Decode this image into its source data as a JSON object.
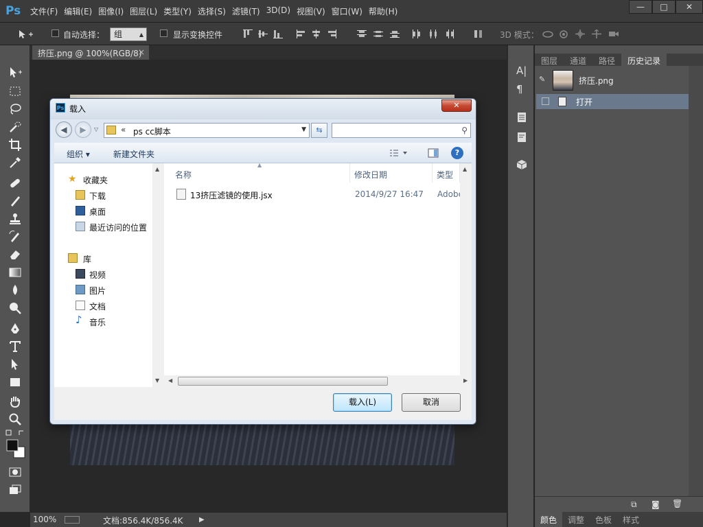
{
  "app": {
    "logo": "Ps",
    "menu": [
      "文件(F)",
      "编辑(E)",
      "图像(I)",
      "图层(L)",
      "类型(Y)",
      "选择(S)",
      "滤镜(T)",
      "3D(D)",
      "视图(V)",
      "窗口(W)",
      "帮助(H)"
    ]
  },
  "window_controls": {
    "minimize": "—",
    "maximize": "□",
    "close": "✕"
  },
  "options_bar": {
    "auto_select_label": "自动选择：",
    "auto_select_value": "组",
    "show_transform_label": "显示变换控件",
    "mode_3d_label": "3D 模式："
  },
  "document": {
    "tab_title": "挤压.png @ 100%(RGB/8)",
    "tab_close": "×"
  },
  "status": {
    "zoom": "100%",
    "doc_info": "文档:856.4K/856.4K"
  },
  "panel": {
    "tabs": [
      "图层",
      "通道",
      "路径",
      "历史记录"
    ],
    "active_tab": "历史记录",
    "snapshot_name": "挤压.png",
    "history_items": [
      "打开"
    ],
    "bottom_tabs": [
      "颜色",
      "调整",
      "色板",
      "样式"
    ]
  },
  "dialog": {
    "title": "载入",
    "close": "✕",
    "back": "◀",
    "forward": "▶",
    "path_chevron": "«",
    "path": "ps cc脚本",
    "search_placeholder": "",
    "organize": "组织 ▾",
    "new_folder": "新建文件夹",
    "help": "?",
    "nav": {
      "favorites": "收藏夹",
      "favorites_items": [
        "下载",
        "桌面",
        "最近访问的位置"
      ],
      "library": "库",
      "library_items": [
        "视频",
        "图片",
        "文档",
        "音乐"
      ]
    },
    "columns": {
      "name": "名称",
      "date": "修改日期",
      "type": "类型"
    },
    "files": [
      {
        "name": "13挤压滤镜的使用.jsx",
        "date": "2014/9/27 16:47",
        "type": "Adobe"
      }
    ],
    "load_button": "载入(L)",
    "cancel_button": "取消"
  },
  "colors": {
    "accent": "#4aa3df",
    "history_select": "#6a7a8c",
    "dialog_frame": "#4d6079"
  }
}
